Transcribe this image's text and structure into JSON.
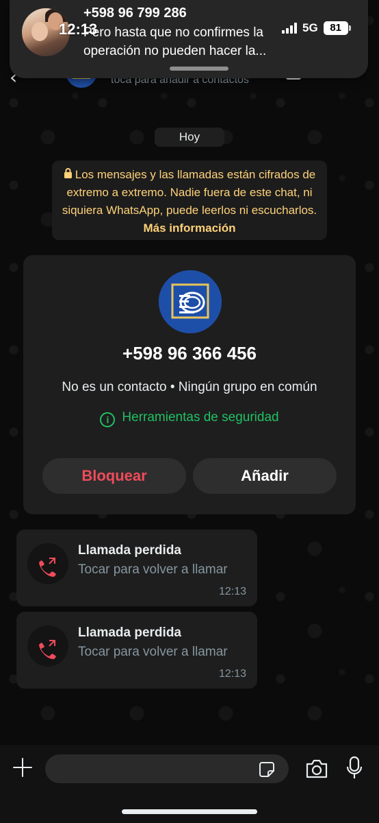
{
  "notification": {
    "time": "12:13",
    "title": "+598 96 799 286",
    "body": "Pero  hasta que no confirmes la operación no pueden hacer la...",
    "network": "5G",
    "battery": "81"
  },
  "header": {
    "back_icon": "chevron-left-icon",
    "subtitle": "toca para añadir a contactos"
  },
  "chat": {
    "date_chip": "Hoy",
    "encryption": {
      "text": "Los mensajes y las llamadas están cifrados de extremo a extremo. Nadie fuera de este chat, ni siquiera WhatsApp, puede leerlos ni escucharlos.",
      "link": "Más información",
      "color": "#ffd279"
    },
    "contact_card": {
      "phone": "+598 96 366 456",
      "info": "No es un contacto • Ningún grupo en común",
      "security_tools": "Herramientas de seguridad",
      "block_label": "Bloquear",
      "add_label": "Añadir",
      "accent_green": "#21c063",
      "danger_red": "#ef4b5a"
    },
    "missed_calls": [
      {
        "title": "Llamada perdida",
        "subtitle": "Tocar para volver a llamar",
        "time": "12:13"
      },
      {
        "title": "Llamada perdida",
        "subtitle": "Tocar para volver a llamar",
        "time": "12:13"
      }
    ]
  },
  "composer": {
    "placeholder": "",
    "icons": [
      "plus-icon",
      "sticker-icon",
      "camera-icon",
      "microphone-icon"
    ]
  }
}
